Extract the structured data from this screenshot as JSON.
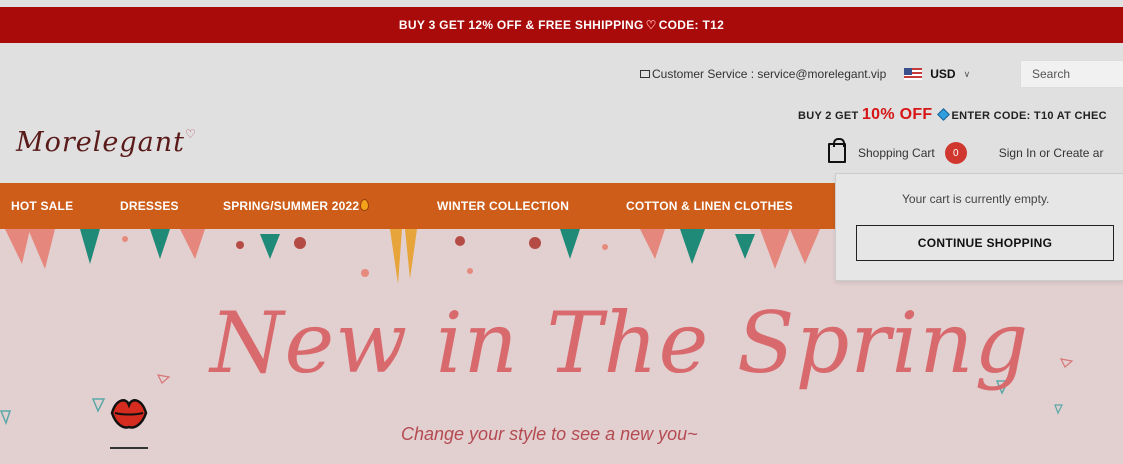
{
  "promo": {
    "text_before": "BUY 3 GET 12% OFF & FREE SHHIPPING",
    "heart": "♡",
    "text_after": "CODE: T12"
  },
  "header": {
    "service_label": "Customer Service : service@morelegant.vip",
    "currency": "USD",
    "search_placeholder": "Search",
    "offer_before": "BUY 2 GET ",
    "offer_big": "10% OFF",
    "offer_after": "ENTER CODE:  T10 AT CHEC",
    "logo": "Morelegant",
    "cart_label": "Shopping Cart",
    "cart_count": "0",
    "signin": "Sign In or Create ar"
  },
  "nav": {
    "items": [
      "HOT SALE",
      "DRESSES",
      "SPRING/SUMMER 2022",
      "WINTER COLLECTION",
      "COTTON & LINEN CLOTHES"
    ]
  },
  "cart_dropdown": {
    "empty_text": "Your cart is currently empty.",
    "continue_label": "CONTINUE SHOPPING"
  },
  "banner": {
    "headline": "New in The Spring",
    "tagline": "Change your style to see a new you~"
  },
  "colors": {
    "promo_bg": "#a90a0a",
    "nav_bg": "#cd5d19",
    "headline": "#d86a6e",
    "badge": "#d0372f"
  }
}
